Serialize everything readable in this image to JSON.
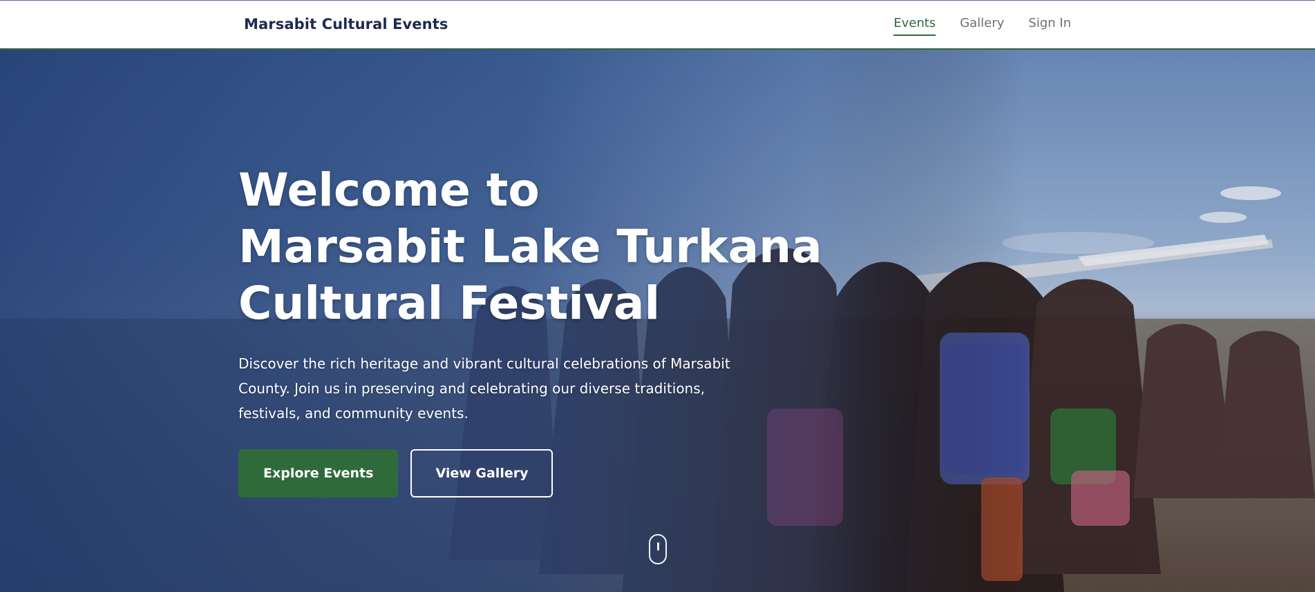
{
  "header": {
    "brand": "Marsabit Cultural Events",
    "nav": [
      {
        "label": "Events",
        "active": true
      },
      {
        "label": "Gallery",
        "active": false
      },
      {
        "label": "Sign In",
        "active": false
      }
    ]
  },
  "hero": {
    "title_lines": [
      "Welcome to",
      "Marsabit Lake Turkana",
      "Cultural Festival"
    ],
    "lede": "Discover the rich heritage and vibrant cultural celebrations of Marsabit County. Join us in preserving and celebrating our diverse traditions, festivals, and community events.",
    "buttons": {
      "primary": "Explore Events",
      "secondary": "View Gallery"
    },
    "scroll_icon": "mouse-scroll-icon"
  },
  "colors": {
    "brand_text": "#1d2a4f",
    "accent_green": "#2f6b3a",
    "nav_inactive": "#6b6f76",
    "hero_overlay": "#234078"
  }
}
